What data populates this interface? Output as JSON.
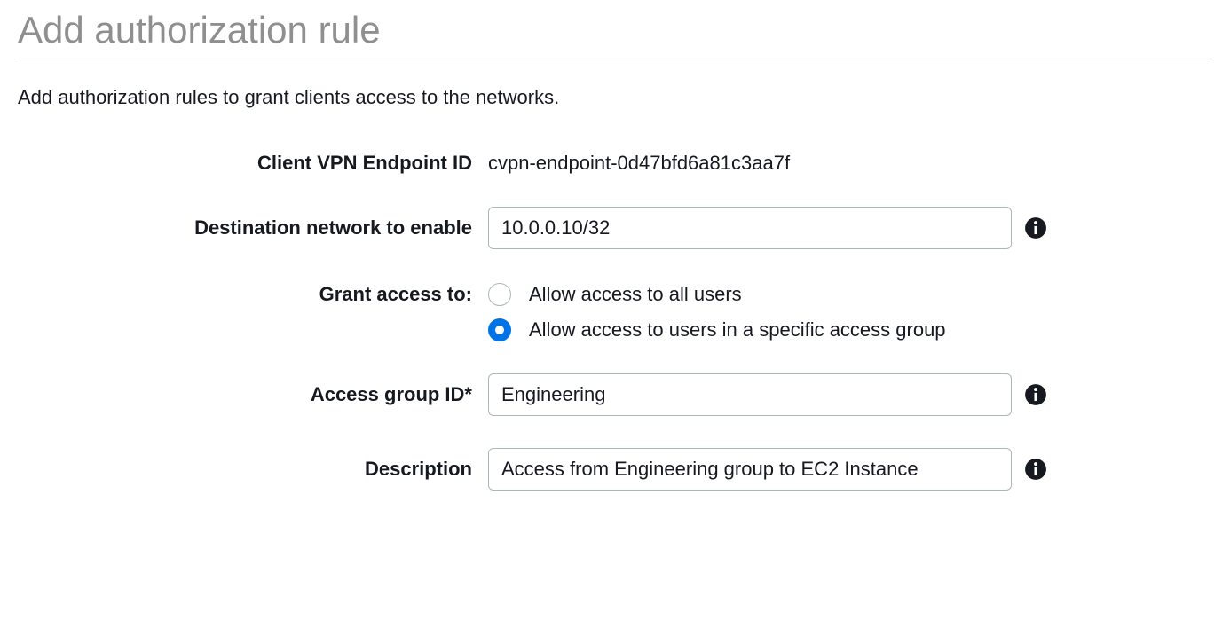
{
  "header": {
    "title": "Add authorization rule",
    "subtitle": "Add authorization rules to grant clients access to the networks."
  },
  "form": {
    "endpoint_id": {
      "label": "Client VPN Endpoint ID",
      "value": "cvpn-endpoint-0d47bfd6a81c3aa7f"
    },
    "destination": {
      "label": "Destination network to enable",
      "value": "10.0.0.10/32"
    },
    "grant_access": {
      "label": "Grant access to:",
      "options": {
        "all": "Allow access to all users",
        "specific": "Allow access to users in a specific access group"
      },
      "selected": "specific"
    },
    "access_group": {
      "label": "Access group ID*",
      "value": "Engineering"
    },
    "description": {
      "label": "Description",
      "value": "Access from Engineering group to EC2 Instance"
    }
  }
}
